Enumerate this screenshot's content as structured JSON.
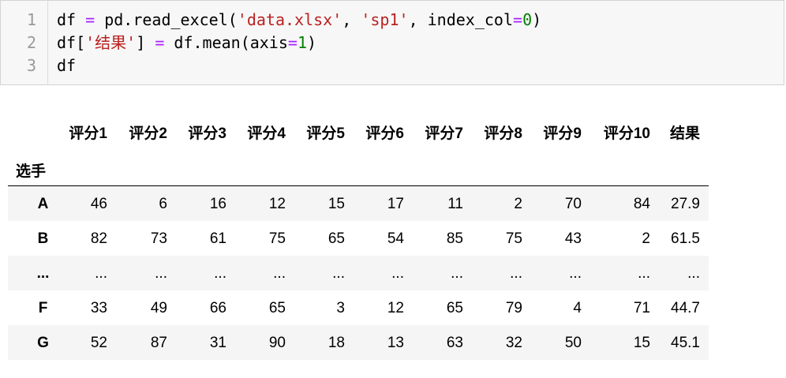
{
  "code_cell": {
    "line_numbers": [
      "1",
      "2",
      "3"
    ],
    "line1": {
      "a": "df ",
      "b": "=",
      "c": " pd.read_excel(",
      "d": "'data.xlsx'",
      "e": ", ",
      "f": "'sp1'",
      "g": ", index_col",
      "h": "=",
      "i": "0",
      "j": ")"
    },
    "line2": {
      "a": "df[",
      "b": "'结果'",
      "c": "] ",
      "d": "=",
      "e": " df.mean(axis",
      "f": "=",
      "g": "1",
      "h": ")"
    },
    "line3": "df"
  },
  "dataframe": {
    "columns": [
      "评分1",
      "评分2",
      "评分3",
      "评分4",
      "评分5",
      "评分6",
      "评分7",
      "评分8",
      "评分9",
      "评分10",
      "结果"
    ],
    "index_name": "选手",
    "rows": [
      {
        "index": "A",
        "values": [
          "46",
          "6",
          "16",
          "12",
          "15",
          "17",
          "11",
          "2",
          "70",
          "84",
          "27.9"
        ]
      },
      {
        "index": "B",
        "values": [
          "82",
          "73",
          "61",
          "75",
          "65",
          "54",
          "85",
          "75",
          "43",
          "2",
          "61.5"
        ]
      },
      {
        "index": "...",
        "values": [
          "...",
          "...",
          "...",
          "...",
          "...",
          "...",
          "...",
          "...",
          "...",
          "...",
          "..."
        ]
      },
      {
        "index": "F",
        "values": [
          "33",
          "49",
          "66",
          "65",
          "3",
          "12",
          "65",
          "79",
          "4",
          "71",
          "44.7"
        ]
      },
      {
        "index": "G",
        "values": [
          "52",
          "87",
          "31",
          "90",
          "18",
          "13",
          "63",
          "32",
          "50",
          "15",
          "45.1"
        ]
      }
    ]
  }
}
